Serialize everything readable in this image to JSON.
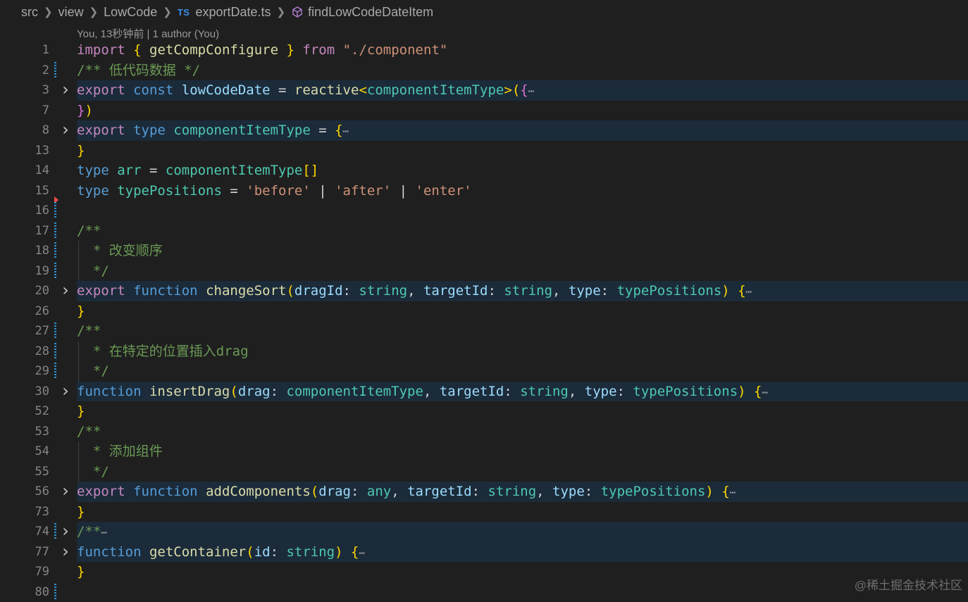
{
  "breadcrumb": {
    "items": [
      "src",
      "view",
      "LowCode",
      "exportDate.ts",
      "findLowCodeDateItem"
    ],
    "file_badge": "TS"
  },
  "codelens": "You, 13秒钟前 | 1 author (You)",
  "lines": [
    {
      "num": "1",
      "fold": false,
      "folded": false,
      "gutter": "none",
      "tokens": [
        [
          "k",
          "import"
        ],
        [
          "p",
          " "
        ],
        [
          "b1",
          "{"
        ],
        [
          "p",
          " "
        ],
        [
          "f",
          "getCompConfigure"
        ],
        [
          "p",
          " "
        ],
        [
          "b1",
          "}"
        ],
        [
          "p",
          " "
        ],
        [
          "k",
          "from"
        ],
        [
          "p",
          " "
        ],
        [
          "str",
          "\"./component\""
        ]
      ]
    },
    {
      "num": "2",
      "fold": false,
      "folded": false,
      "gutter": "mod",
      "tokens": [
        [
          "c",
          "/** 低代码数据 */"
        ]
      ]
    },
    {
      "num": "3",
      "fold": true,
      "folded": true,
      "gutter": "none",
      "tokens": [
        [
          "k",
          "export"
        ],
        [
          "p",
          " "
        ],
        [
          "s",
          "const"
        ],
        [
          "p",
          " "
        ],
        [
          "v",
          "lowCodeDate"
        ],
        [
          "p",
          " = "
        ],
        [
          "f",
          "reactive"
        ],
        [
          "b1",
          "<"
        ],
        [
          "t",
          "componentItemType"
        ],
        [
          "b1",
          ">"
        ],
        [
          "b1",
          "("
        ],
        [
          "b2",
          "{"
        ],
        [
          "ell",
          "⋯"
        ]
      ]
    },
    {
      "num": "7",
      "fold": false,
      "folded": false,
      "gutter": "none",
      "tokens": [
        [
          "b2",
          "}"
        ],
        [
          "b1",
          ")"
        ]
      ]
    },
    {
      "num": "8",
      "fold": true,
      "folded": true,
      "gutter": "none",
      "tokens": [
        [
          "k",
          "export"
        ],
        [
          "p",
          " "
        ],
        [
          "s",
          "type"
        ],
        [
          "p",
          " "
        ],
        [
          "t",
          "componentItemType"
        ],
        [
          "p",
          " = "
        ],
        [
          "b1",
          "{"
        ],
        [
          "ell",
          "⋯"
        ]
      ]
    },
    {
      "num": "13",
      "fold": false,
      "folded": false,
      "gutter": "none",
      "tokens": [
        [
          "b1",
          "}"
        ]
      ]
    },
    {
      "num": "14",
      "fold": false,
      "folded": false,
      "gutter": "none",
      "tokens": [
        [
          "s",
          "type"
        ],
        [
          "p",
          " "
        ],
        [
          "t",
          "arr"
        ],
        [
          "p",
          " = "
        ],
        [
          "t",
          "componentItemType"
        ],
        [
          "b1",
          "[]"
        ]
      ]
    },
    {
      "num": "15",
      "fold": false,
      "folded": false,
      "gutter": "del",
      "tokens": [
        [
          "s",
          "type"
        ],
        [
          "p",
          " "
        ],
        [
          "t",
          "typePositions"
        ],
        [
          "p",
          " = "
        ],
        [
          "str",
          "'before'"
        ],
        [
          "p",
          " | "
        ],
        [
          "str",
          "'after'"
        ],
        [
          "p",
          " | "
        ],
        [
          "str",
          "'enter'"
        ]
      ]
    },
    {
      "num": "16",
      "fold": false,
      "folded": false,
      "gutter": "mod",
      "tokens": []
    },
    {
      "num": "17",
      "fold": false,
      "folded": false,
      "gutter": "mod",
      "tokens": [
        [
          "c",
          "/**"
        ]
      ]
    },
    {
      "num": "18",
      "fold": false,
      "folded": false,
      "gutter": "mod",
      "guide": true,
      "tokens": [
        [
          "c",
          "  * 改变顺序"
        ]
      ]
    },
    {
      "num": "19",
      "fold": false,
      "folded": false,
      "gutter": "mod",
      "guide": true,
      "tokens": [
        [
          "c",
          "  */"
        ]
      ]
    },
    {
      "num": "20",
      "fold": true,
      "folded": true,
      "gutter": "none",
      "tokens": [
        [
          "k",
          "export"
        ],
        [
          "p",
          " "
        ],
        [
          "s",
          "function"
        ],
        [
          "p",
          " "
        ],
        [
          "f",
          "changeSort"
        ],
        [
          "b1",
          "("
        ],
        [
          "v",
          "dragId"
        ],
        [
          "p",
          ": "
        ],
        [
          "t",
          "string"
        ],
        [
          "p",
          ", "
        ],
        [
          "v",
          "targetId"
        ],
        [
          "p",
          ": "
        ],
        [
          "t",
          "string"
        ],
        [
          "p",
          ", "
        ],
        [
          "v",
          "type"
        ],
        [
          "p",
          ": "
        ],
        [
          "t",
          "typePositions"
        ],
        [
          "b1",
          ")"
        ],
        [
          "p",
          " "
        ],
        [
          "b1",
          "{"
        ],
        [
          "ell",
          "⋯"
        ]
      ]
    },
    {
      "num": "26",
      "fold": false,
      "folded": false,
      "gutter": "none",
      "tokens": [
        [
          "b1",
          "}"
        ]
      ]
    },
    {
      "num": "27",
      "fold": false,
      "folded": false,
      "gutter": "mod",
      "tokens": [
        [
          "c",
          "/**"
        ]
      ]
    },
    {
      "num": "28",
      "fold": false,
      "folded": false,
      "gutter": "mod",
      "guide": true,
      "tokens": [
        [
          "c",
          "  * 在特定的位置插入drag"
        ]
      ]
    },
    {
      "num": "29",
      "fold": false,
      "folded": false,
      "gutter": "mod",
      "guide": true,
      "tokens": [
        [
          "c",
          "  */"
        ]
      ]
    },
    {
      "num": "30",
      "fold": true,
      "folded": true,
      "gutter": "none",
      "tokens": [
        [
          "s",
          "function"
        ],
        [
          "p",
          " "
        ],
        [
          "f",
          "insertDrag"
        ],
        [
          "b1",
          "("
        ],
        [
          "v",
          "drag"
        ],
        [
          "p",
          ": "
        ],
        [
          "t",
          "componentItemType"
        ],
        [
          "p",
          ", "
        ],
        [
          "v",
          "targetId"
        ],
        [
          "p",
          ": "
        ],
        [
          "t",
          "string"
        ],
        [
          "p",
          ", "
        ],
        [
          "v",
          "type"
        ],
        [
          "p",
          ": "
        ],
        [
          "t",
          "typePositions"
        ],
        [
          "b1",
          ")"
        ],
        [
          "p",
          " "
        ],
        [
          "b1",
          "{"
        ],
        [
          "ell",
          "⋯"
        ]
      ]
    },
    {
      "num": "52",
      "fold": false,
      "folded": false,
      "gutter": "none",
      "tokens": [
        [
          "b1",
          "}"
        ]
      ]
    },
    {
      "num": "53",
      "fold": false,
      "folded": false,
      "gutter": "none",
      "tokens": [
        [
          "c",
          "/**"
        ]
      ]
    },
    {
      "num": "54",
      "fold": false,
      "folded": false,
      "gutter": "none",
      "guide": true,
      "tokens": [
        [
          "c",
          "  * 添加组件"
        ]
      ]
    },
    {
      "num": "55",
      "fold": false,
      "folded": false,
      "gutter": "none",
      "guide": true,
      "tokens": [
        [
          "c",
          "  */"
        ]
      ]
    },
    {
      "num": "56",
      "fold": true,
      "folded": true,
      "gutter": "none",
      "tokens": [
        [
          "k",
          "export"
        ],
        [
          "p",
          " "
        ],
        [
          "s",
          "function"
        ],
        [
          "p",
          " "
        ],
        [
          "f",
          "addComponents"
        ],
        [
          "b1",
          "("
        ],
        [
          "v",
          "drag"
        ],
        [
          "p",
          ": "
        ],
        [
          "t",
          "any"
        ],
        [
          "p",
          ", "
        ],
        [
          "v",
          "targetId"
        ],
        [
          "p",
          ": "
        ],
        [
          "t",
          "string"
        ],
        [
          "p",
          ", "
        ],
        [
          "v",
          "type"
        ],
        [
          "p",
          ": "
        ],
        [
          "t",
          "typePositions"
        ],
        [
          "b1",
          ")"
        ],
        [
          "p",
          " "
        ],
        [
          "b1",
          "{"
        ],
        [
          "ell",
          "⋯"
        ]
      ]
    },
    {
      "num": "73",
      "fold": false,
      "folded": false,
      "gutter": "none",
      "tokens": [
        [
          "b1",
          "}"
        ]
      ]
    },
    {
      "num": "74",
      "fold": true,
      "folded": true,
      "gutter": "mod",
      "tokens": [
        [
          "c",
          "/**"
        ],
        [
          "ell",
          "⋯"
        ]
      ]
    },
    {
      "num": "77",
      "fold": true,
      "folded": true,
      "gutter": "none",
      "tokens": [
        [
          "s",
          "function"
        ],
        [
          "p",
          " "
        ],
        [
          "f",
          "getContainer"
        ],
        [
          "b1",
          "("
        ],
        [
          "v",
          "id"
        ],
        [
          "p",
          ": "
        ],
        [
          "t",
          "string"
        ],
        [
          "b1",
          ")"
        ],
        [
          "p",
          " "
        ],
        [
          "b1",
          "{"
        ],
        [
          "ell",
          "⋯"
        ]
      ]
    },
    {
      "num": "79",
      "fold": false,
      "folded": false,
      "gutter": "none",
      "tokens": [
        [
          "b1",
          "}"
        ]
      ]
    },
    {
      "num": "80",
      "fold": false,
      "folded": false,
      "gutter": "mod",
      "tokens": []
    }
  ],
  "icons": {
    "fold_chevron": "chevron-right-icon",
    "symbol": "symbol-method-icon"
  },
  "watermark": "@稀土掘金技术社区"
}
